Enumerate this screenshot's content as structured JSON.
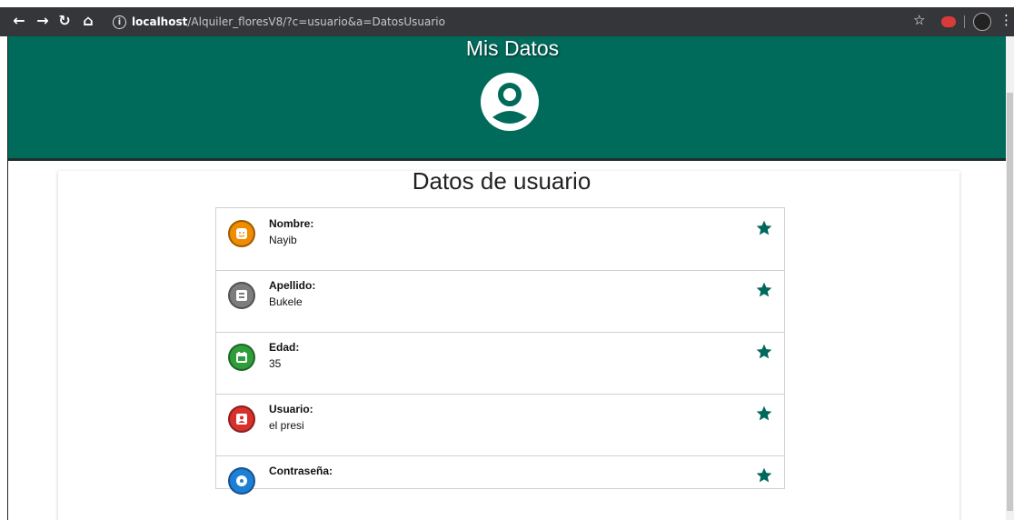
{
  "browser": {
    "url_host": "localhost",
    "url_path": "/Alquiler_floresV8/?c=usuario&a=DatosUsuario"
  },
  "header": {
    "title": "Mis Datos",
    "icon": "account-circle-icon",
    "background": "#006b5b"
  },
  "card": {
    "title": "Datos de usuario"
  },
  "items": [
    {
      "label": "Nombre:",
      "value": "Nayib",
      "icon": "face-icon",
      "color": "#ef8c00"
    },
    {
      "label": "Apellido:",
      "value": "Bukele",
      "icon": "badge-icon",
      "color": "#7d7d7d"
    },
    {
      "label": "Edad:",
      "value": "35",
      "icon": "calendar-icon",
      "color": "#2e9d3a"
    },
    {
      "label": "Usuario:",
      "value": "el presi",
      "icon": "user-box-icon",
      "color": "#d8302c"
    },
    {
      "label": "Contraseña:",
      "value": "",
      "icon": "lock-icon",
      "color": "#1e7fd6"
    }
  ],
  "star_color": "#00695c"
}
